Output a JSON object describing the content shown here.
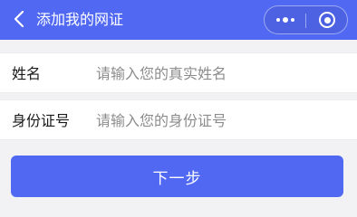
{
  "colors": {
    "accent": "#5169f2",
    "background": "#f2f2f4"
  },
  "navbar": {
    "title": "添加我的网证",
    "back_icon": "chevron-left-icon",
    "more_icon": "more-dots-icon",
    "close_icon": "target-circle-icon"
  },
  "form": {
    "name": {
      "label": "姓名",
      "value": "",
      "placeholder": "请输入您的真实姓名"
    },
    "id_number": {
      "label": "身份证号",
      "value": "",
      "placeholder": "请输入您的身份证号"
    }
  },
  "actions": {
    "next_label": "下一步"
  }
}
